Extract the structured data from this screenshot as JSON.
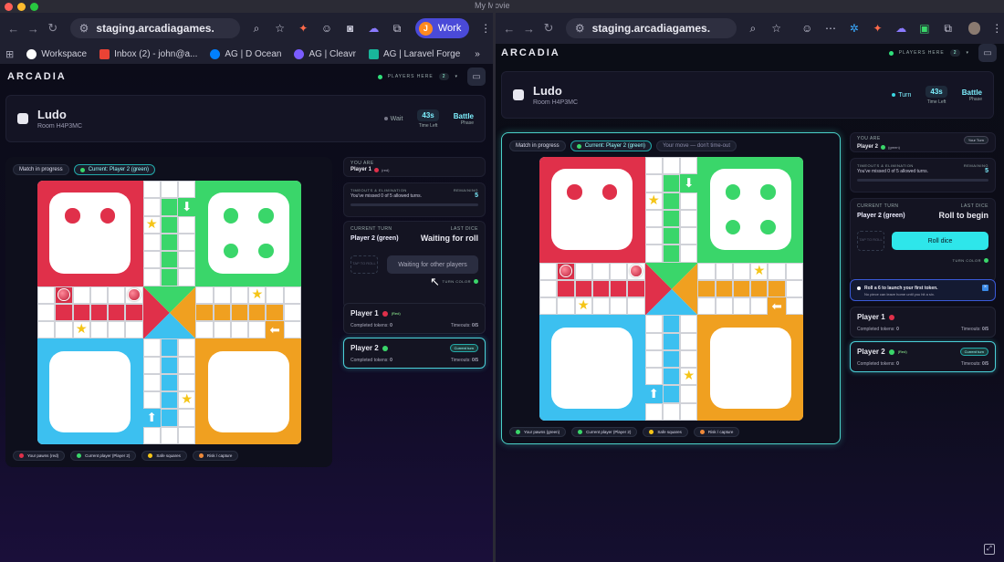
{
  "window": {
    "title": "My Movie"
  },
  "left": {
    "browser": {
      "url": "staging.arcadiagames.",
      "profile": {
        "initial": "J",
        "label": "Work"
      },
      "bookmarks": [
        {
          "label": "Workspace",
          "icon": "google-icon",
          "color": "#ffffff"
        },
        {
          "label": "Inbox (2) - john@a...",
          "icon": "gmail-icon",
          "color": "#ea4335"
        },
        {
          "label": "AG | D Ocean",
          "icon": "digitalocean-icon",
          "color": "#0080ff"
        },
        {
          "label": "AG | Cleavr",
          "icon": "cleavr-icon",
          "color": "#7a5cff"
        },
        {
          "label": "AG | Laravel Forge",
          "icon": "forge-icon",
          "color": "#19b69b"
        }
      ],
      "more": "»"
    }
  },
  "right": {
    "browser": {
      "url": "staging.arcadiagames."
    }
  },
  "app": {
    "logo": "ARCADIA",
    "players_here_label": "PLAYERS HERE",
    "players_here_count": "2",
    "game": {
      "title": "Ludo",
      "room": "Room H4P3MC"
    },
    "phase_label": "Phase",
    "phase_value": "Battle",
    "time_left_label": "Time Left",
    "time_left": "43s",
    "match_chip": "Match in progress",
    "current_chip": "Current: Player 2 (green)",
    "your_move_chip": "Your move — don't time-out",
    "legend": [
      {
        "label": "Your pawns (red)",
        "color": "#e0304a"
      },
      {
        "label": "Current player (Player 2)",
        "color": "#3ad66a"
      },
      {
        "label": "Safe squares",
        "color": "#f5c518"
      },
      {
        "label": "Risk / capture",
        "color": "#f08a3a"
      }
    ],
    "legend_right": [
      {
        "label": "Your pawns (green)",
        "color": "#3ad66a"
      },
      {
        "label": "Current player (Player 2)",
        "color": "#3ad66a"
      },
      {
        "label": "Safe squares",
        "color": "#f5c518"
      },
      {
        "label": "Risk / capture",
        "color": "#f08a3a"
      }
    ],
    "you_are_label": "YOU ARE",
    "timeouts_label": "TIMEOUTS & ELIMINATION",
    "timeouts_text": "You've missed 0 of 5 allowed turns.",
    "remaining_label": "REMAINING",
    "remaining_value": "5",
    "current_turn_label": "CURRENT TURN",
    "last_dice_label": "LAST DICE",
    "turn_color_label": "TURN COLOR",
    "completed_label": "Completed tokens:",
    "timeouts_short": "Timeouts:",
    "current_turn_badge": "Current turn",
    "your_turn_badge": "Your Turn",
    "players": [
      {
        "name": "Player 1",
        "color": "#e0304a",
        "tag": "(Red)",
        "completed": "0",
        "timeouts": "0/5"
      },
      {
        "name": "Player 2",
        "color": "#3ad66a",
        "tag": "(Red)",
        "completed": "0",
        "timeouts": "0/5"
      }
    ]
  },
  "left_state": {
    "status": "Wait",
    "you_are": "Player 1",
    "you_tag": "(red)",
    "current_turn": "Player 2 (green)",
    "last_dice": "Waiting for roll",
    "tap_label": "TAP TO ROLL",
    "button": "Waiting for other players"
  },
  "right_state": {
    "status": "Turn",
    "you_are": "Player 2",
    "you_tag": "(green)",
    "current_turn": "Player 2 (green)",
    "last_dice": "Roll to begin",
    "tap_label": "TAP TO ROLL",
    "button": "Roll dice",
    "tip_title": "Roll a 6 to launch your first token.",
    "tip_text": "No piece can leave home until you hit a six.",
    "close": "×"
  }
}
